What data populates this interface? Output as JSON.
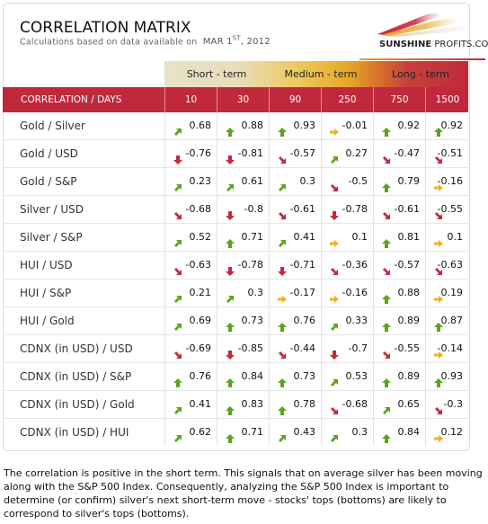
{
  "header": {
    "title": "CORRELATION MATRIX",
    "subtitle": "Calculations based on data available on",
    "date_main": "MAR 1",
    "date_sup": "ST",
    "date_year": ", 2012",
    "logo_bold": "SUNSHINE",
    "logo_rest": " PROFITS.COM"
  },
  "terms": [
    {
      "label": "Short - term"
    },
    {
      "label": "Medium - term"
    },
    {
      "label": "Long - term"
    }
  ],
  "columns": {
    "label": "CORRELATION / DAYS",
    "days": [
      "10",
      "30",
      "90",
      "250",
      "750",
      "1500"
    ]
  },
  "colors": {
    "header_red": "#c0283c",
    "arrow_up": "#5aa51f",
    "arrow_flat": "#f0b020",
    "arrow_down": "#c8283c"
  },
  "rows": [
    {
      "label": "Gold / Silver",
      "cells": [
        {
          "value": "0.68",
          "trend": "up-right"
        },
        {
          "value": "0.88",
          "trend": "up"
        },
        {
          "value": "0.93",
          "trend": "up"
        },
        {
          "value": "-0.01",
          "trend": "right"
        },
        {
          "value": "0.92",
          "trend": "up"
        },
        {
          "value": "0.92",
          "trend": "up"
        }
      ]
    },
    {
      "label": "Gold / USD",
      "cells": [
        {
          "value": "-0.76",
          "trend": "down"
        },
        {
          "value": "-0.81",
          "trend": "down"
        },
        {
          "value": "-0.57",
          "trend": "down-right"
        },
        {
          "value": "0.27",
          "trend": "up-right"
        },
        {
          "value": "-0.47",
          "trend": "down-right"
        },
        {
          "value": "-0.51",
          "trend": "down-right"
        }
      ]
    },
    {
      "label": "Gold / S&P",
      "cells": [
        {
          "value": "0.23",
          "trend": "up-right"
        },
        {
          "value": "0.61",
          "trend": "up-right"
        },
        {
          "value": "0.3",
          "trend": "up-right"
        },
        {
          "value": "-0.5",
          "trend": "down-right"
        },
        {
          "value": "0.79",
          "trend": "up"
        },
        {
          "value": "-0.16",
          "trend": "right"
        }
      ]
    },
    {
      "label": "Silver / USD",
      "cells": [
        {
          "value": "-0.68",
          "trend": "down-right"
        },
        {
          "value": "-0.8",
          "trend": "down"
        },
        {
          "value": "-0.61",
          "trend": "down-right"
        },
        {
          "value": "-0.78",
          "trend": "down"
        },
        {
          "value": "-0.61",
          "trend": "down-right"
        },
        {
          "value": "-0.55",
          "trend": "down-right"
        }
      ]
    },
    {
      "label": "Silver / S&P",
      "cells": [
        {
          "value": "0.52",
          "trend": "up-right"
        },
        {
          "value": "0.71",
          "trend": "up"
        },
        {
          "value": "0.41",
          "trend": "up-right"
        },
        {
          "value": "0.1",
          "trend": "right"
        },
        {
          "value": "0.81",
          "trend": "up"
        },
        {
          "value": "0.1",
          "trend": "right"
        }
      ]
    },
    {
      "label": "HUI / USD",
      "cells": [
        {
          "value": "-0.63",
          "trend": "down-right"
        },
        {
          "value": "-0.78",
          "trend": "down"
        },
        {
          "value": "-0.71",
          "trend": "down"
        },
        {
          "value": "-0.36",
          "trend": "down-right"
        },
        {
          "value": "-0.57",
          "trend": "down-right"
        },
        {
          "value": "-0.63",
          "trend": "down-right"
        }
      ]
    },
    {
      "label": "HUI / S&P",
      "cells": [
        {
          "value": "0.21",
          "trend": "up-right"
        },
        {
          "value": "0.3",
          "trend": "up-right"
        },
        {
          "value": "-0.17",
          "trend": "right"
        },
        {
          "value": "-0.16",
          "trend": "right"
        },
        {
          "value": "0.88",
          "trend": "up"
        },
        {
          "value": "0.19",
          "trend": "right"
        }
      ]
    },
    {
      "label": "HUI / Gold",
      "cells": [
        {
          "value": "0.69",
          "trend": "up-right"
        },
        {
          "value": "0.73",
          "trend": "up"
        },
        {
          "value": "0.76",
          "trend": "up"
        },
        {
          "value": "0.33",
          "trend": "up-right"
        },
        {
          "value": "0.89",
          "trend": "up"
        },
        {
          "value": "0.87",
          "trend": "up"
        }
      ]
    },
    {
      "label": "CDNX (in USD) / USD",
      "cells": [
        {
          "value": "-0.69",
          "trend": "down-right"
        },
        {
          "value": "-0.85",
          "trend": "down"
        },
        {
          "value": "-0.44",
          "trend": "down-right"
        },
        {
          "value": "-0.7",
          "trend": "down"
        },
        {
          "value": "-0.55",
          "trend": "down-right"
        },
        {
          "value": "-0.14",
          "trend": "right"
        }
      ]
    },
    {
      "label": "CDNX (in USD) / S&P",
      "cells": [
        {
          "value": "0.76",
          "trend": "up"
        },
        {
          "value": "0.84",
          "trend": "up"
        },
        {
          "value": "0.73",
          "trend": "up"
        },
        {
          "value": "0.53",
          "trend": "up-right"
        },
        {
          "value": "0.89",
          "trend": "up"
        },
        {
          "value": "0.93",
          "trend": "up"
        }
      ]
    },
    {
      "label": "CDNX (in USD) / Gold",
      "cells": [
        {
          "value": "0.41",
          "trend": "up-right"
        },
        {
          "value": "0.83",
          "trend": "up"
        },
        {
          "value": "0.78",
          "trend": "up"
        },
        {
          "value": "-0.68",
          "trend": "down-right"
        },
        {
          "value": "0.65",
          "trend": "up-right"
        },
        {
          "value": "-0.3",
          "trend": "down-right"
        }
      ]
    },
    {
      "label": "CDNX (in USD) / HUI",
      "cells": [
        {
          "value": "0.62",
          "trend": "up-right"
        },
        {
          "value": "0.71",
          "trend": "up"
        },
        {
          "value": "0.43",
          "trend": "up-right"
        },
        {
          "value": "0.3",
          "trend": "up-right"
        },
        {
          "value": "0.84",
          "trend": "up"
        },
        {
          "value": "0.12",
          "trend": "right"
        }
      ]
    }
  ],
  "note": "The correlation is positive in the short term. This signals that on average silver has been moving along with the S&P 500 Index. Consequently, analyzing the S&P 500 Index is important to determine (or confirm) silver's next short-term move - stocks' tops (bottoms) are likely to correspond to silver's tops (bottoms)."
}
